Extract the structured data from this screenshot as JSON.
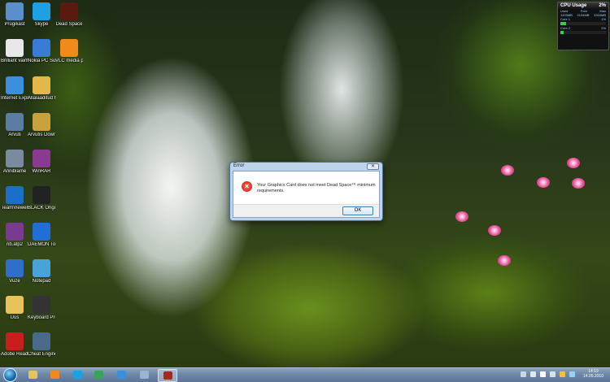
{
  "desktop_icons": [
    {
      "label": "Prügikast",
      "icon": "recycle-bin-icon",
      "color": "#5a8fc9"
    },
    {
      "label": "Skype",
      "icon": "skype-icon",
      "color": "#1da1e2"
    },
    {
      "label": "Dead Space",
      "icon": "dead-space-icon",
      "color": "#5a1a10"
    },
    {
      "label": "Brilliant vaimine",
      "icon": "notepad-icon",
      "color": "#e8e8e8"
    },
    {
      "label": "Nokia PC Suite",
      "icon": "nokia-pc-suite-icon",
      "color": "#3a7bd5"
    },
    {
      "label": "VLC media player",
      "icon": "vlc-icon",
      "color": "#f28a1b"
    },
    {
      "label": "Internet Explorer",
      "icon": "internet-explorer-icon",
      "color": "#3b8fdc"
    },
    {
      "label": "Allalaaditud failid otsetee",
      "icon": "folder-shortcut-icon",
      "color": "#e3b84a"
    },
    {
      "label": "Arvuti",
      "icon": "computer-icon",
      "color": "#5b7da3"
    },
    {
      "label": "Arvutis Downloa...",
      "icon": "downloads-icon",
      "color": "#c8a23a"
    },
    {
      "label": "Anniblame",
      "icon": "game-icon",
      "color": "#7a8ba0"
    },
    {
      "label": "WinRAR",
      "icon": "winrar-icon",
      "color": "#8a3a8f"
    },
    {
      "label": "TeamViewer",
      "icon": "teamviewer-icon",
      "color": "#1b6fc9"
    },
    {
      "label": "BLACK Origins",
      "icon": "black-origins-icon",
      "color": "#222222"
    },
    {
      "label": "rib.atp2",
      "icon": "archive-icon",
      "color": "#7a3a8f"
    },
    {
      "label": "DAEMON Tools Lite",
      "icon": "daemon-tools-icon",
      "color": "#1f6fd6"
    },
    {
      "label": "Vuze",
      "icon": "vuze-icon",
      "color": "#2f6fc9"
    },
    {
      "label": "Notepad",
      "icon": "notepad-icon",
      "color": "#4aa3d8"
    },
    {
      "label": "Uus",
      "icon": "folder-icon",
      "color": "#e8c25a"
    },
    {
      "label": "Keyboard Pro",
      "icon": "keyboard-icon",
      "color": "#333333"
    },
    {
      "label": "Adobe Reader 9",
      "icon": "adobe-reader-icon",
      "color": "#c81e1e"
    },
    {
      "label": "Cheat Engine",
      "icon": "cheat-engine-icon",
      "color": "#4a6a8a"
    }
  ],
  "cpu_gadget": {
    "title": "CPU Usage",
    "total": "2%",
    "rows": [
      {
        "left": "Used",
        "mid": "Free",
        "right": "Max"
      },
      {
        "left": "1203MB",
        "mid": "2134MB",
        "right": "3334MB"
      },
      {
        "left": "Core 1",
        "mid": "",
        "right": "1%"
      },
      {
        "left": "Core 2",
        "mid": "",
        "right": "2%"
      }
    ],
    "core_levels": [
      0.12,
      0.08
    ]
  },
  "dialog": {
    "title": "Error",
    "close_label": "✕",
    "message": "Your Graphics Card does not meet Dead Space™ minimum requirements.",
    "ok_label": "OK"
  },
  "taskbar": {
    "pinned": [
      {
        "icon": "explorer-folder-icon",
        "color": "#e8c25a"
      },
      {
        "icon": "media-player-icon",
        "color": "#f28a1b"
      },
      {
        "icon": "skype-icon",
        "color": "#1da1e2"
      },
      {
        "icon": "pc-suite-icon",
        "color": "#3aa35a"
      },
      {
        "icon": "internet-explorer-icon",
        "color": "#3b8fdc"
      },
      {
        "icon": "notepad-icon",
        "color": "#9ab3d0"
      },
      {
        "icon": "dead-space-icon",
        "color": "#a8281c"
      }
    ],
    "clock_time": "14:19",
    "clock_date": "14.05.2010"
  }
}
